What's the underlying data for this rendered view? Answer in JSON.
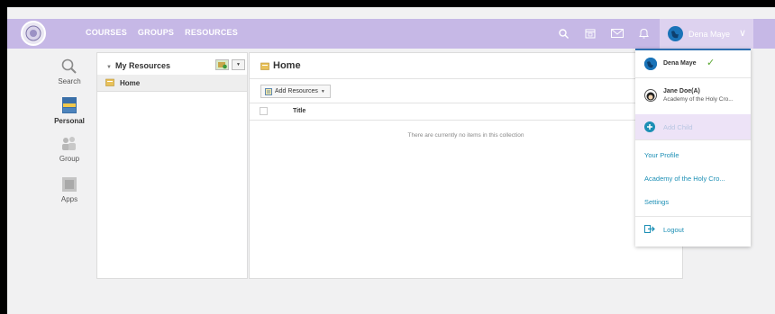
{
  "topbar": {
    "nav": [
      "COURSES",
      "GROUPS",
      "RESOURCES"
    ],
    "user_name": "Dena Maye"
  },
  "rail": [
    {
      "label": "Search"
    },
    {
      "label": "Personal"
    },
    {
      "label": "Group"
    },
    {
      "label": "Apps"
    }
  ],
  "tree": {
    "header": "My Resources",
    "items": [
      "Home"
    ]
  },
  "main": {
    "title": "Home",
    "add_resources": "Add Resources",
    "column_title": "Title",
    "empty_message": "There are currently no items in this collection"
  },
  "dropdown": {
    "current_user": "Dena Maye",
    "child_name": "Jane Doe(A)",
    "child_school": "Academy of the Holy Cro...",
    "add_child": "Add Child",
    "your_profile": "Your Profile",
    "academy": "Academy of the Holy Cro...",
    "settings": "Settings",
    "logout": "Logout"
  },
  "colors": {
    "topbar": "#c6b8e6",
    "accent_blue": "#1c8fb5",
    "dropdown_border": "#2e6fb0",
    "add_child_bg": "#ede3f7"
  }
}
